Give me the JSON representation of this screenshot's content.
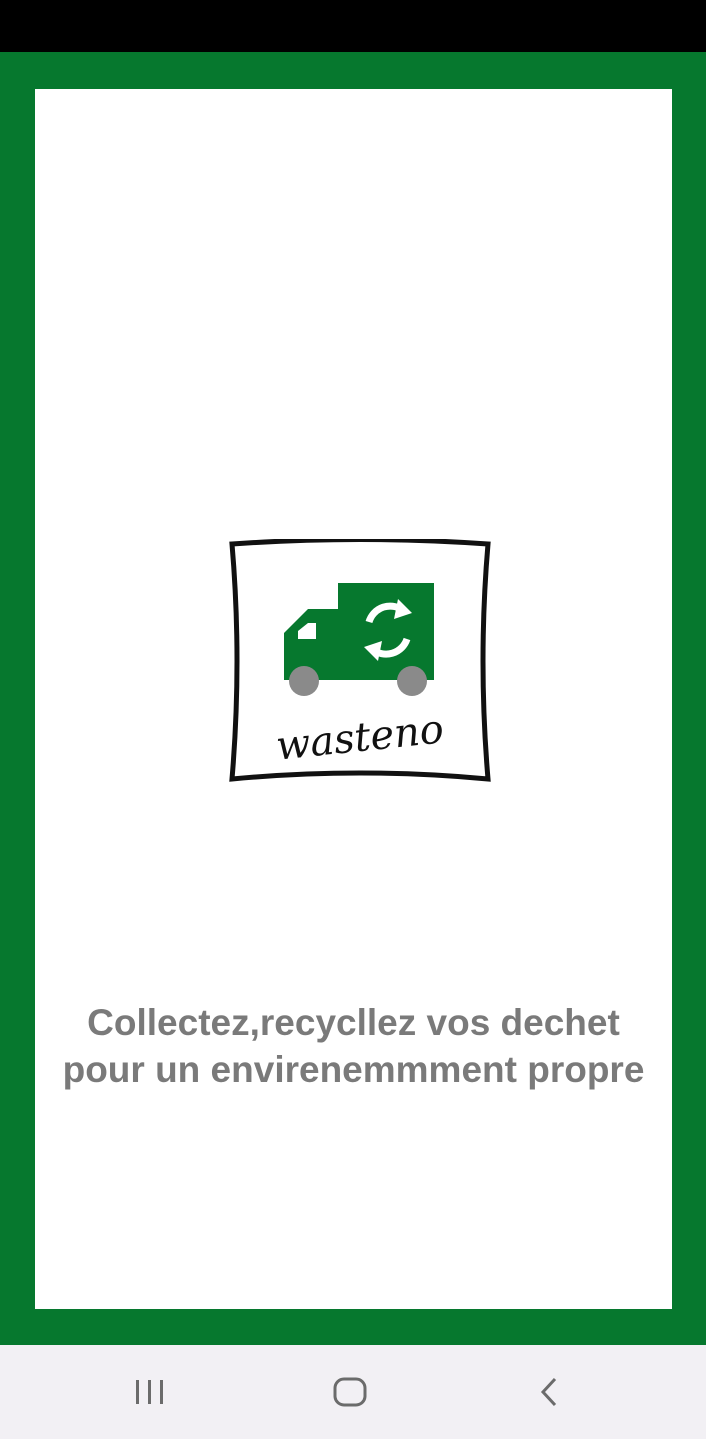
{
  "colors": {
    "frame_green": "#06782e",
    "panel_white": "#ffffff",
    "tagline_gray": "#7a7a7a",
    "nav_bar_bg": "#f2f0f4",
    "nav_icon": "#6b6b6b"
  },
  "splash": {
    "logo": {
      "icon": "wasteno-truck-recycle-logo",
      "wordmark": "wasteno"
    },
    "tagline_line1": "Collectez,recycllez vos dechet",
    "tagline_line2": "pour un envirenemmment propre"
  },
  "nav_bar": {
    "recents_icon": "recents-icon",
    "home_icon": "home-icon",
    "back_icon": "back-icon"
  }
}
